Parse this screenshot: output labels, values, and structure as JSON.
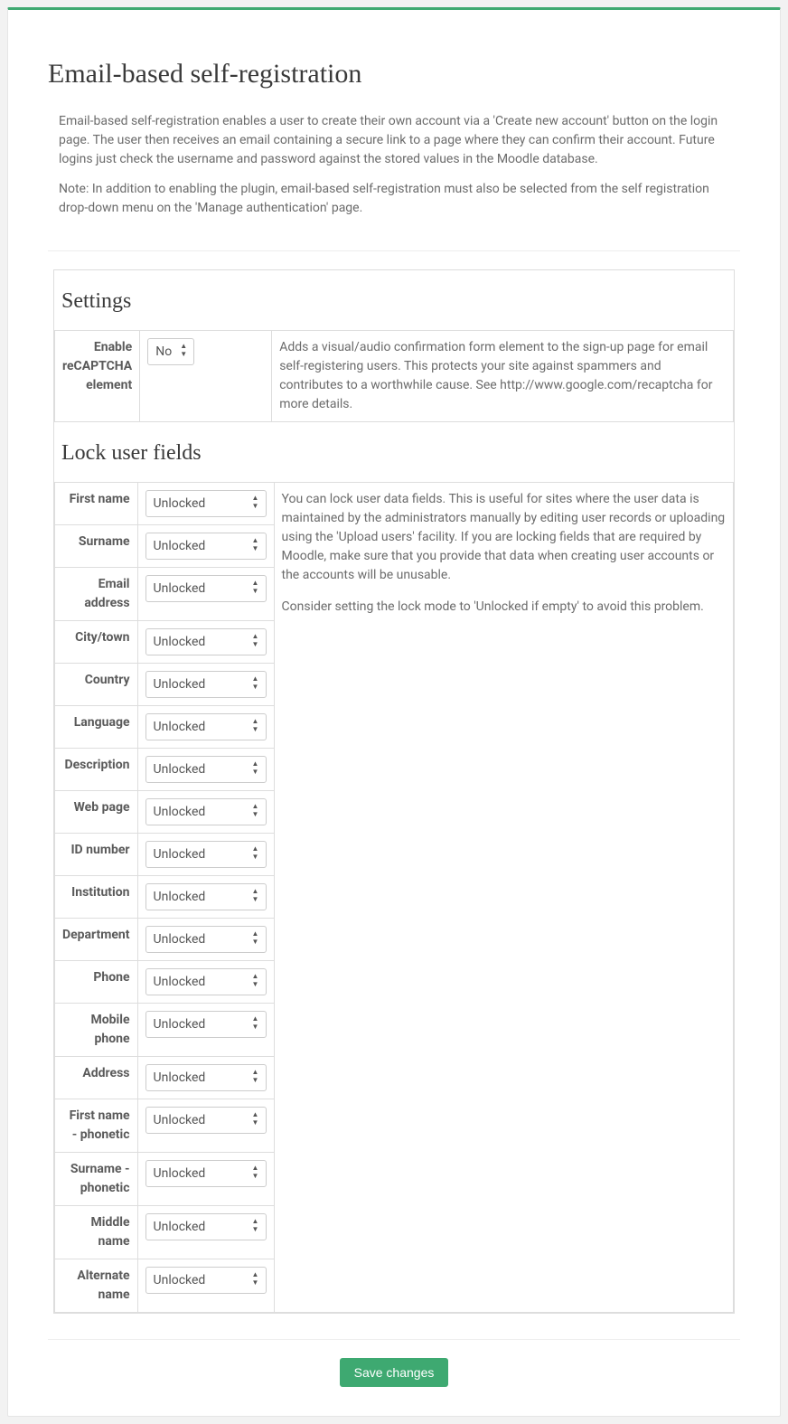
{
  "page": {
    "title": "Email-based self-registration",
    "intro1": "Email-based self-registration enables a user to create their own account via a 'Create new account' button on the login page. The user then receives an email containing a secure link to a page where they can confirm their account. Future logins just check the username and password against the stored values in the Moodle database.",
    "intro2": "Note: In addition to enabling the plugin, email-based self-registration must also be selected from the self registration drop-down menu on the 'Manage authentication' page."
  },
  "settings": {
    "heading": "Settings",
    "recaptcha": {
      "label": "Enable reCAPTCHA element",
      "value": "No",
      "desc": "Adds a visual/audio confirmation form element to the sign-up page for email self-registering users. This protects your site against spammers and contributes to a worthwhile cause. See http://www.google.com/recaptcha for more details."
    }
  },
  "lock": {
    "heading": "Lock user fields",
    "desc1": "You can lock user data fields. This is useful for sites where the user data is maintained by the administrators manually by editing user records or uploading using the 'Upload users' facility. If you are locking fields that are required by Moodle, make sure that you provide that data when creating user accounts or the accounts will be unusable.",
    "desc2": "Consider setting the lock mode to 'Unlocked if empty' to avoid this problem.",
    "fields": [
      {
        "label": "First name",
        "value": "Unlocked"
      },
      {
        "label": "Surname",
        "value": "Unlocked"
      },
      {
        "label": "Email address",
        "value": "Unlocked"
      },
      {
        "label": "City/town",
        "value": "Unlocked"
      },
      {
        "label": "Country",
        "value": "Unlocked"
      },
      {
        "label": "Language",
        "value": "Unlocked"
      },
      {
        "label": "Description",
        "value": "Unlocked"
      },
      {
        "label": "Web page",
        "value": "Unlocked"
      },
      {
        "label": "ID number",
        "value": "Unlocked"
      },
      {
        "label": "Institution",
        "value": "Unlocked"
      },
      {
        "label": "Department",
        "value": "Unlocked"
      },
      {
        "label": "Phone",
        "value": "Unlocked"
      },
      {
        "label": "Mobile phone",
        "value": "Unlocked"
      },
      {
        "label": "Address",
        "value": "Unlocked"
      },
      {
        "label": "First name - phonetic",
        "value": "Unlocked"
      },
      {
        "label": "Surname - phonetic",
        "value": "Unlocked"
      },
      {
        "label": "Middle name",
        "value": "Unlocked"
      },
      {
        "label": "Alternate name",
        "value": "Unlocked"
      }
    ]
  },
  "buttons": {
    "save": "Save changes"
  }
}
